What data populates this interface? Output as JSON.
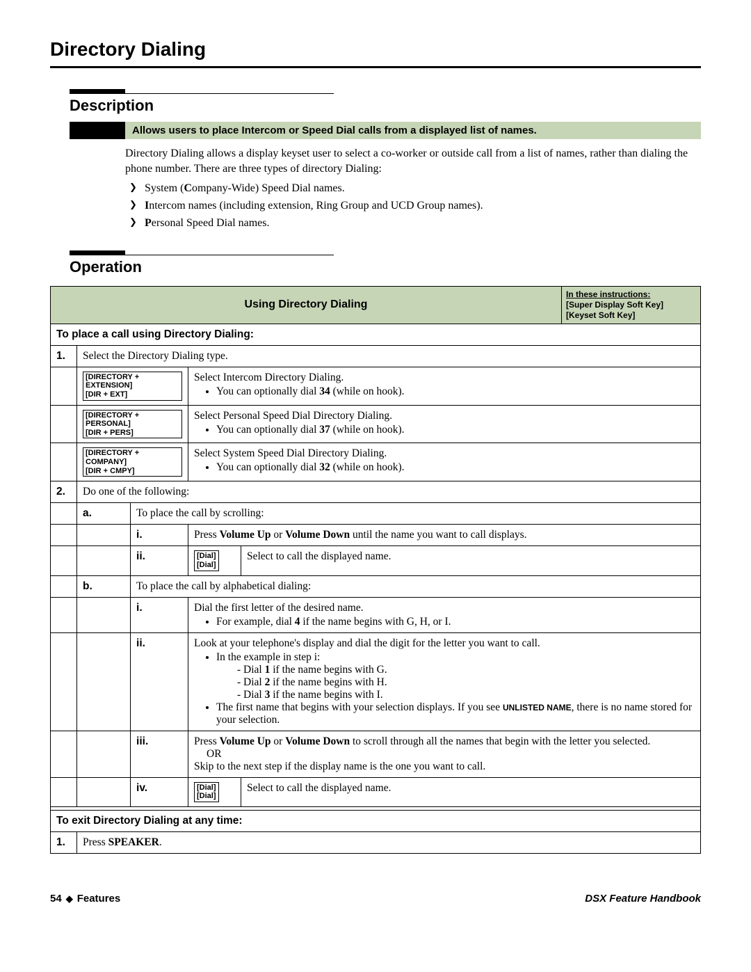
{
  "page_title": "Directory Dialing",
  "description": {
    "heading": "Description",
    "summary": "Allows users to place Intercom or Speed Dial calls from a displayed list of names.",
    "intro": "Directory Dialing allows a display keyset user to select a co-worker or outside call from a list of names, rather than dialing the phone number. There are three types of directory Dialing:",
    "bullets": {
      "b1_bold": "C",
      "b1_rest": "ompany-Wide) Speed Dial names.",
      "b1_pre": "System (",
      "b2_bold": "I",
      "b2_rest": "ntercom names (including extension, Ring Group and UCD Group names).",
      "b3_bold": "P",
      "b3_rest": "ersonal Speed Dial names."
    }
  },
  "operation": {
    "heading": "Operation",
    "table_title": "Using Directory Dialing",
    "instr_line1": "In these instructions:",
    "instr_line2": "[Super Display Soft Key]",
    "instr_line3": "[Keyset Soft Key]",
    "section1": "To place a call using Directory Dialing:",
    "row1_num": "1.",
    "row1_text": "Select the Directory Dialing type.",
    "key1_l1": "[DIRECTORY + EXTENSION]",
    "key1_l2": "[DIR + EXT]",
    "key1_text": "Select Intercom Directory Dialing.",
    "key1_sub_a": "You can optionally dial ",
    "key1_sub_b": "34",
    "key1_sub_c": " (while on hook).",
    "key2_l1": "[DIRECTORY + PERSONAL]",
    "key2_l2": "[DIR + PERS]",
    "key2_text": "Select Personal Speed Dial Directory Dialing.",
    "key2_sub_a": "You can optionally dial ",
    "key2_sub_b": "37",
    "key2_sub_c": " (while on hook).",
    "key3_l1": "[DIRECTORY + COMPANY]",
    "key3_l2": "[DIR + CMPY]",
    "key3_text": "Select System Speed Dial Directory Dialing.",
    "key3_sub_a": "You can optionally dial ",
    "key3_sub_b": "32",
    "key3_sub_c": " (while on hook).",
    "row2_num": "2.",
    "row2_text": "Do one of the following:",
    "a_label": "a.",
    "a_text": "To place the call by scrolling:",
    "a_i": "i.",
    "a_i_text_a": "Press ",
    "a_i_text_b": "Volume Up",
    "a_i_text_c": " or ",
    "a_i_text_d": "Volume Down",
    "a_i_text_e": " until the name you want to call displays.",
    "a_ii": "ii.",
    "dial_l1": "[Dial]",
    "dial_l2": "[Dial]",
    "a_ii_text": "Select to call the displayed name.",
    "b_label": "b.",
    "b_text": "To place the call by alphabetical dialing:",
    "b_i": "i.",
    "b_i_text": "Dial the first letter of the desired name.",
    "b_i_sub_a": "For example, dial ",
    "b_i_sub_b": "4",
    "b_i_sub_c": " if the name begins with G, H, or I.",
    "b_ii": "ii.",
    "b_ii_line1": "Look at your telephone's display and dial the digit for the letter you want to call.",
    "b_ii_sub1": "In the example in step i:",
    "b_ii_d1a": "- Dial ",
    "b_ii_d1b": "1",
    "b_ii_d1c": " if the name begins with G.",
    "b_ii_d2a": "- Dial ",
    "b_ii_d2b": "2",
    "b_ii_d2c": " if the name begins with H.",
    "b_ii_d3a": "- Dial ",
    "b_ii_d3b": "3",
    "b_ii_d3c": " if the name begins with I.",
    "b_ii_sub2a": "The first name that begins with your selection displays. If you see ",
    "b_ii_sub2b": "UNLISTED NAME",
    "b_ii_sub2c": ", there is no name stored for your selection.",
    "b_iii": "iii.",
    "b_iii_l1a": "Press ",
    "b_iii_l1b": "Volume Up",
    "b_iii_l1c": " or ",
    "b_iii_l1d": "Volume Down",
    "b_iii_l1e": " to scroll through all the names that begin with the letter you selected.",
    "b_iii_or": "OR",
    "b_iii_l2": "Skip to the next step if the display name is the one you want to call.",
    "b_iv": "iv.",
    "b_iv_text": "Select to call the displayed name.",
    "section2": "To exit Directory Dialing at any time:",
    "exit_num": "1.",
    "exit_text_a": "Press ",
    "exit_text_b": "SPEAKER",
    "exit_text_c": "."
  },
  "footer": {
    "page_num": "54",
    "left_label": "Features",
    "right_label": "DSX Feature Handbook"
  }
}
